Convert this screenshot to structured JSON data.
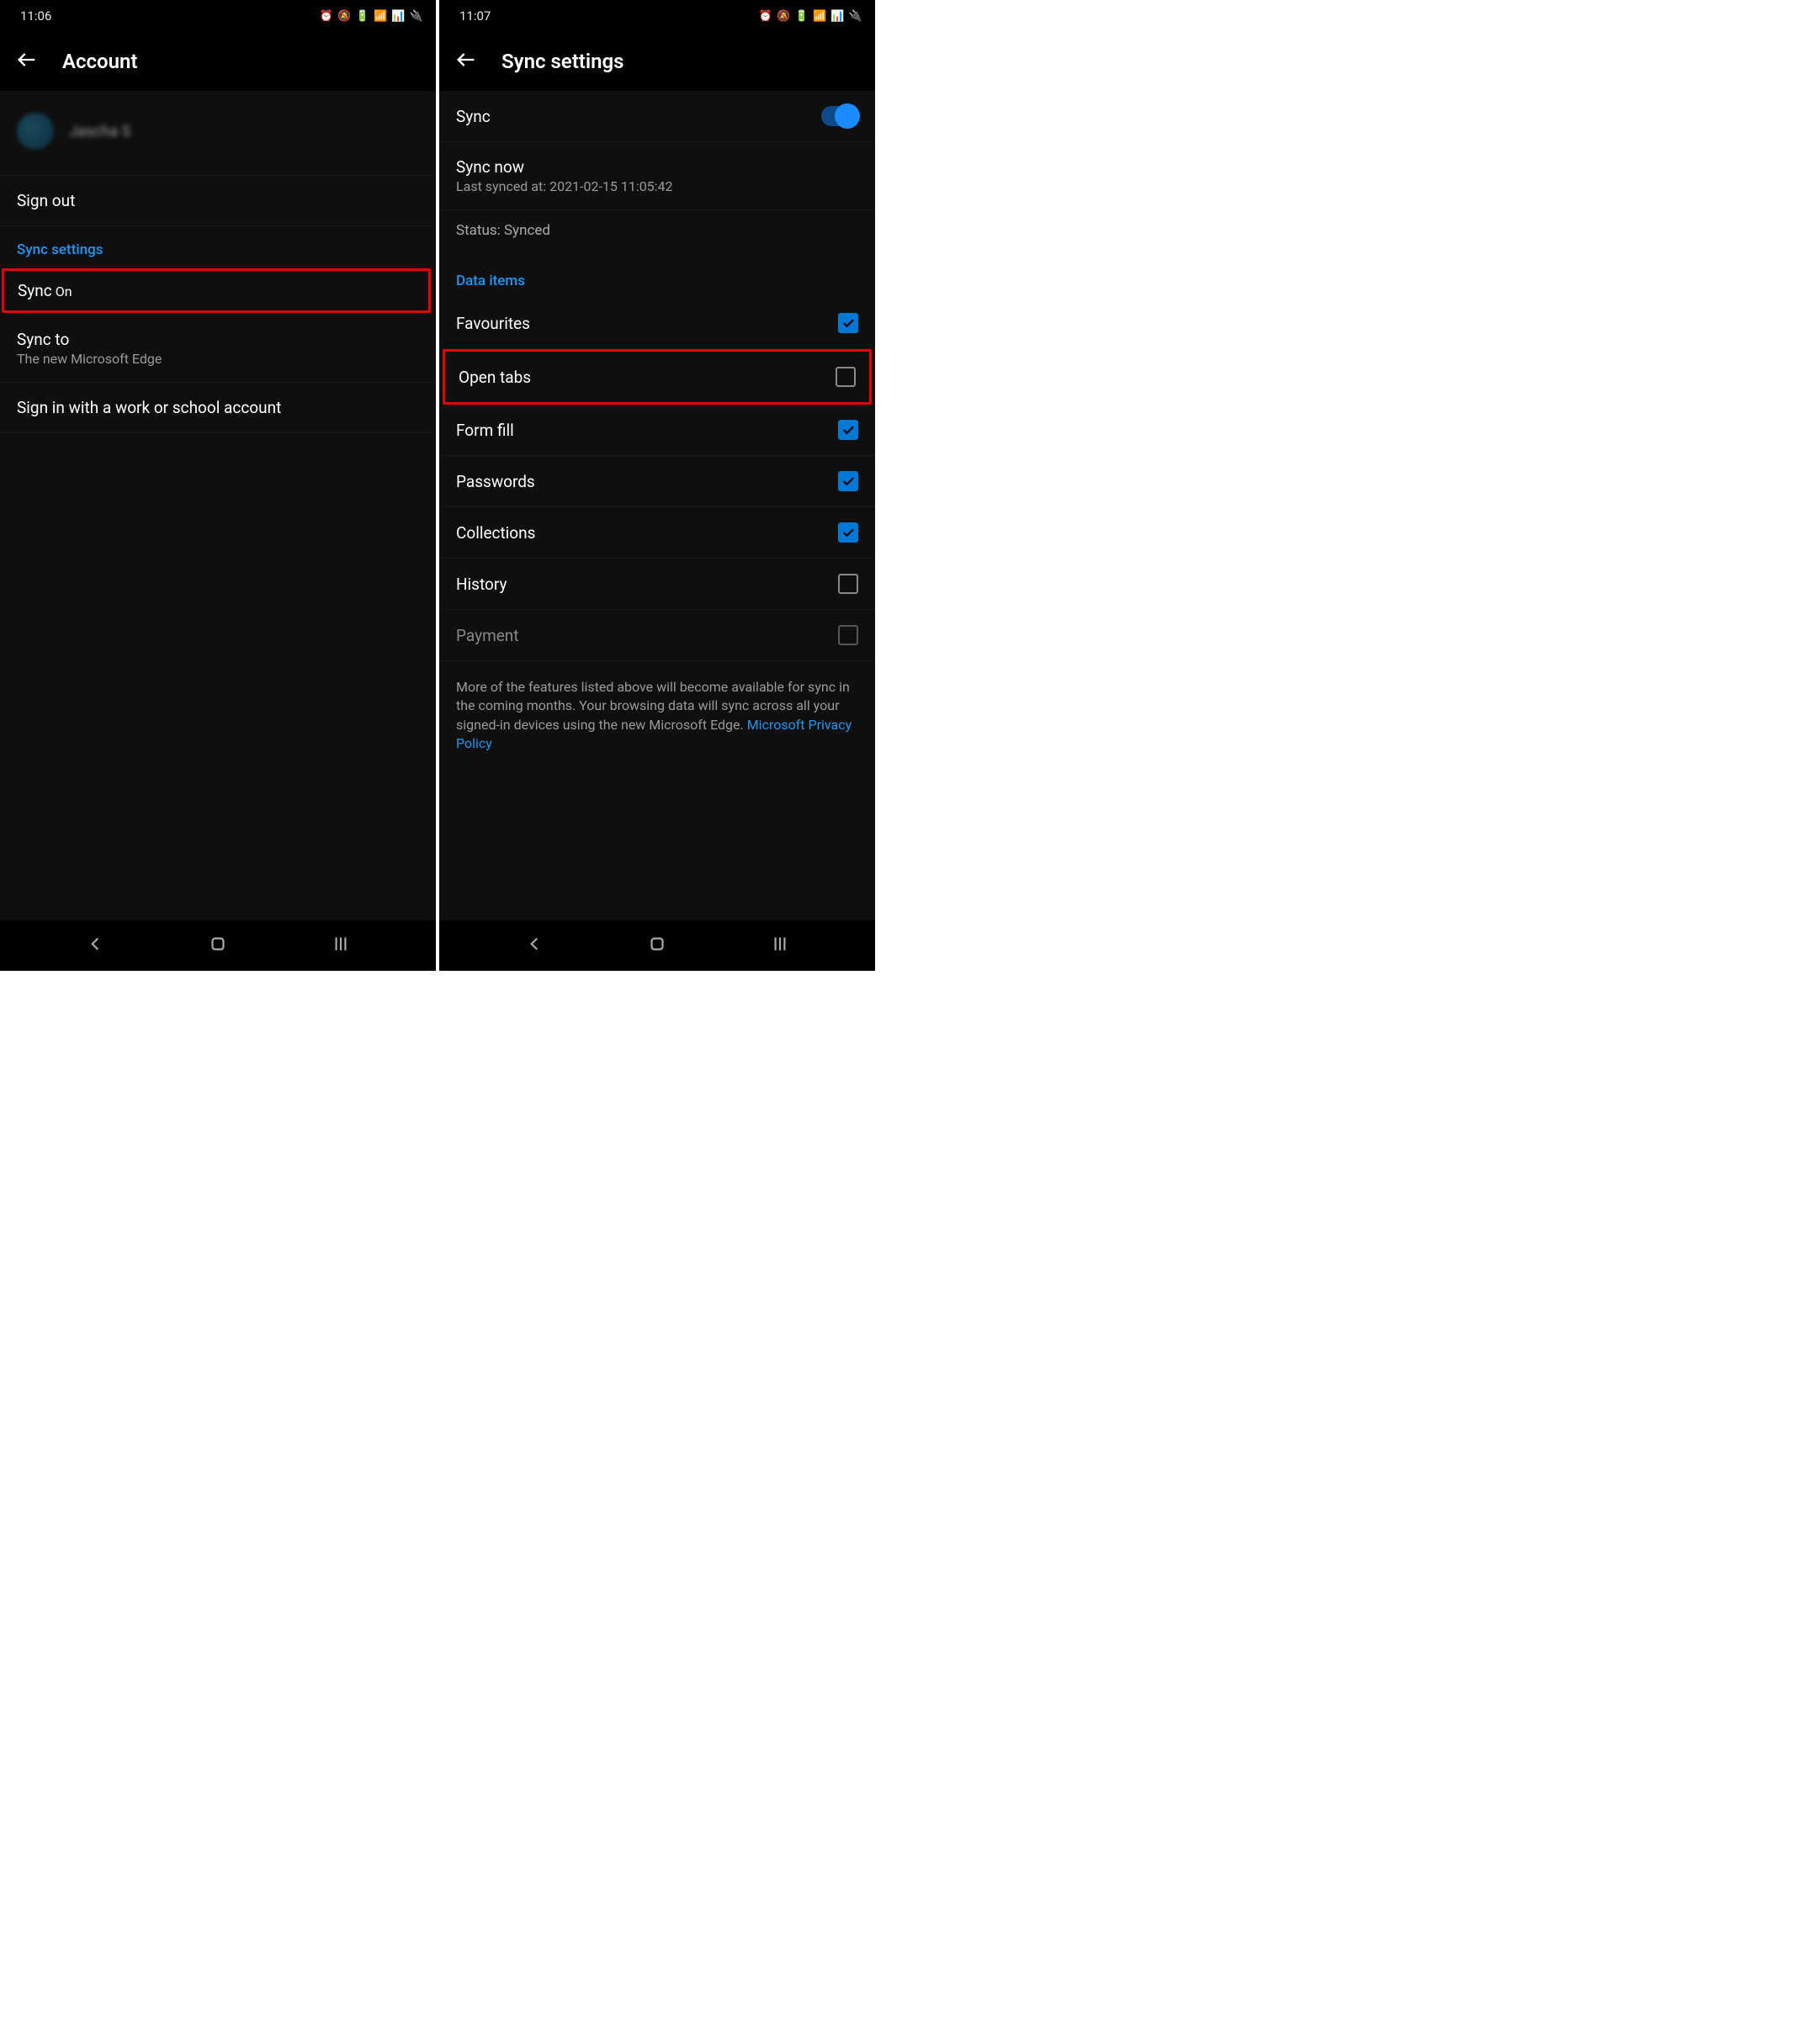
{
  "left": {
    "statusbar": {
      "time": "11:06",
      "icons": "⏰ 🔕 🔋 📶 📊 🔌"
    },
    "appbar": {
      "title": "Account"
    },
    "profile": {
      "name": "Jascha S"
    },
    "rows": {
      "signout": "Sign out",
      "section": "Sync settings",
      "sync": {
        "label": "Sync",
        "value": "On"
      },
      "syncto": {
        "label": "Sync to",
        "value": "The new Microsoft Edge"
      },
      "workschool": "Sign in with a work or school account"
    }
  },
  "right": {
    "statusbar": {
      "time": "11:07",
      "icons": "⏰ 🔕 🔋 📶 📊 🔌"
    },
    "appbar": {
      "title": "Sync settings"
    },
    "sync": {
      "label": "Sync",
      "on": true
    },
    "syncnow": {
      "label": "Sync now",
      "sub": "Last synced at: 2021-02-15 11:05:42"
    },
    "status": "Status: Synced",
    "section": "Data items",
    "items": [
      {
        "label": "Favourites",
        "checked": true,
        "disabled": false
      },
      {
        "label": "Open tabs",
        "checked": false,
        "disabled": false
      },
      {
        "label": "Form fill",
        "checked": true,
        "disabled": false
      },
      {
        "label": "Passwords",
        "checked": true,
        "disabled": false
      },
      {
        "label": "Collections",
        "checked": true,
        "disabled": false
      },
      {
        "label": "History",
        "checked": false,
        "disabled": false
      },
      {
        "label": "Payment",
        "checked": false,
        "disabled": true
      }
    ],
    "footer": {
      "text": "More of the features listed above will become available for sync in the coming months. Your browsing data will sync across all your signed-in devices using the new Microsoft Edge. ",
      "link": "Microsoft Privacy Policy"
    }
  }
}
